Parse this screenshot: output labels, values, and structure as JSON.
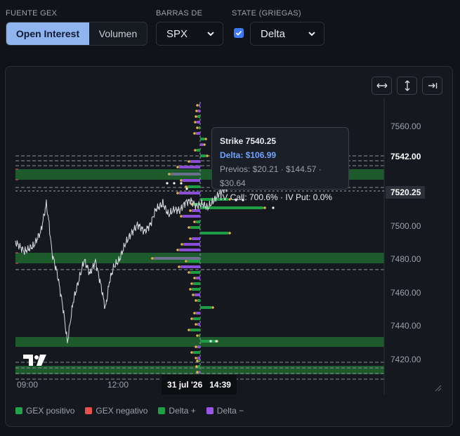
{
  "controls": {
    "source_label": "FUENTE GEX",
    "source_options": [
      "Open Interest",
      "Volumen"
    ],
    "bars_label": "BARRAS DE",
    "bars_value": "SPX",
    "state_label": "STATE (GRIEGAS)",
    "state_value": "Delta",
    "state_checked": true
  },
  "toolbar": {
    "icons": [
      "fit-width-icon",
      "fit-height-icon",
      "scroll-to-end-icon"
    ]
  },
  "price_axis": [
    "7560.00",
    "7500.00",
    "7480.00",
    "7460.00",
    "7440.00",
    "7420.00"
  ],
  "price_tags": {
    "upper": "7542.00",
    "current": "7520.25"
  },
  "time_axis": [
    "09:00",
    "12:00"
  ],
  "crosshair_time": {
    "date": "31 jul '26",
    "time": "14:39"
  },
  "tooltip": {
    "strike": "Strike 7540.25",
    "delta": "Delta: $106.99",
    "previous": "Previos: $20.21 · $144.57 · $30.64",
    "iv": "IV Call: 700.6% · IV Put: 0.0%"
  },
  "legend": [
    {
      "label": "GEX positivo",
      "color": "#22a447"
    },
    {
      "label": "GEX negativo",
      "color": "#e8504b"
    },
    {
      "label": "Delta +",
      "color": "#1f9d44"
    },
    {
      "label": "Delta −",
      "color": "#9a55e6"
    }
  ],
  "colors": {
    "accent": "#8fb4ee",
    "gex_zone": "#1d5a2c",
    "delta_pos": "#1f9d44",
    "delta_neg": "#8a4fd6"
  }
}
